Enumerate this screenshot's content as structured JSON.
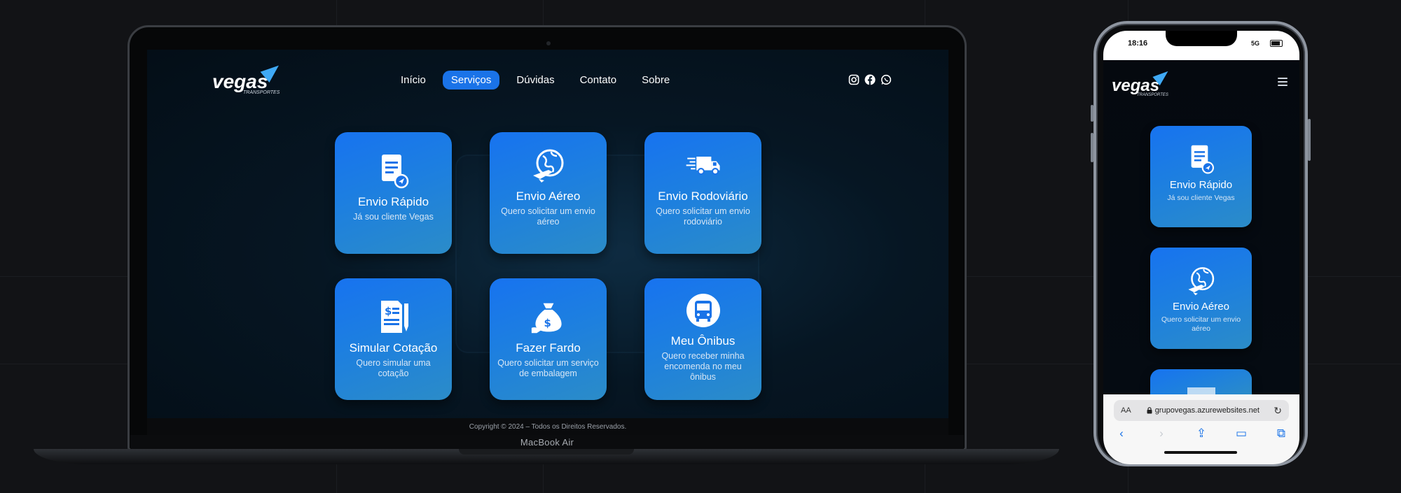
{
  "macbook": {
    "label": "MacBook Air",
    "site": {
      "logo": {
        "word": "vegas",
        "sub": "TRANSPORTES"
      },
      "nav": [
        {
          "label": "Início",
          "active": false
        },
        {
          "label": "Serviços",
          "active": true
        },
        {
          "label": "Dúvidas",
          "active": false
        },
        {
          "label": "Contato",
          "active": false
        },
        {
          "label": "Sobre",
          "active": false
        }
      ],
      "social": [
        "instagram-icon",
        "facebook-icon",
        "whatsapp-icon"
      ],
      "cards": [
        {
          "title": "Envio Rápido",
          "desc": "Já sou cliente Vegas",
          "icon": "document-send-icon"
        },
        {
          "title": "Envio Aéreo",
          "desc": "Quero solicitar um envio aéreo",
          "icon": "globe-plane-icon"
        },
        {
          "title": "Envio Rodoviário",
          "desc": "Quero solicitar um envio rodoviário",
          "icon": "truck-icon"
        },
        {
          "title": "Simular Cotação",
          "desc": "Quero simular uma cotação",
          "icon": "quote-document-icon"
        },
        {
          "title": "Fazer Fardo",
          "desc": "Quero solicitar um serviço de embalagem",
          "icon": "money-bag-icon"
        },
        {
          "title": "Meu Ônibus",
          "desc": "Quero receber minha encomenda no meu ônibus",
          "icon": "bus-icon"
        }
      ],
      "footer": "Copyright © 2024 – Todos os Direitos Reservados."
    }
  },
  "iphone": {
    "time": "18:16",
    "signal": "5G",
    "logo": {
      "word": "vegas",
      "sub": "TRANSPORTES"
    },
    "cards": [
      {
        "title": "Envio Rápido",
        "desc": "Já sou cliente Vegas",
        "icon": "document-send-icon"
      },
      {
        "title": "Envio Aéreo",
        "desc": "Quero solicitar um envio aéreo",
        "icon": "globe-plane-icon"
      }
    ],
    "url": "grupovegas.azurewebsites.net",
    "url_aa": "AA"
  },
  "colors": {
    "accent": "#1a73e8",
    "card_top": "#1773f0",
    "card_bottom": "#2b8cc8",
    "background": "#121316"
  }
}
